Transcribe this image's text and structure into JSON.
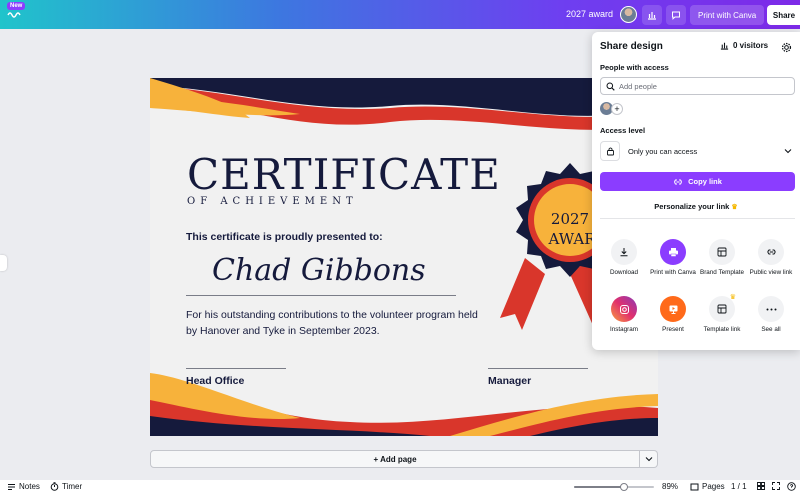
{
  "header": {
    "new_badge": "New",
    "doc_title": "2027 award",
    "print_label": "Print with Canva",
    "share_label": "Share",
    "colors": {
      "gradient_start": "#20c4cb",
      "gradient_end": "#7d2ae8"
    }
  },
  "certificate": {
    "title": "CERTIFICATE",
    "subtitle": "OF ACHIEVEMENT",
    "presented": "This certificate is proudly presented to:",
    "name": "Chad Gibbons",
    "body": "For his outstanding contributions to the volunteer program held by Hanover and Tyke in September 2023.",
    "award_line1": "2027",
    "award_line2": "AWAR",
    "sig_left": "Head Office",
    "sig_right": "Manager",
    "colors": {
      "navy": "#151a3c",
      "red": "#d9362b",
      "gold": "#f7b23b"
    }
  },
  "canvas": {
    "add_page_label": "+ Add page"
  },
  "status": {
    "notes_label": "Notes",
    "timer_label": "Timer",
    "zoom": "89%",
    "zoom_fraction": 0.62,
    "pages_label": "Pages",
    "page_counter": "1 / 1"
  },
  "share_panel": {
    "title": "Share design",
    "visitors": "0 visitors",
    "people_label": "People with access",
    "add_people_placeholder": "Add people",
    "access_level_label": "Access level",
    "access_value": "Only you can access",
    "copy_link": "Copy link",
    "personalize": "Personalize your link",
    "options": [
      {
        "label": "Download",
        "icon": "download-icon"
      },
      {
        "label": "Print with Canva",
        "icon": "print-icon"
      },
      {
        "label": "Brand Template",
        "icon": "brand-template-icon"
      },
      {
        "label": "Public view link",
        "icon": "link-icon"
      },
      {
        "label": "Instagram",
        "icon": "instagram-icon"
      },
      {
        "label": "Present",
        "icon": "present-icon"
      },
      {
        "label": "Template link",
        "icon": "template-link-icon"
      },
      {
        "label": "See all",
        "icon": "more-icon"
      }
    ],
    "colors": {
      "accent": "#8b3dff"
    }
  }
}
